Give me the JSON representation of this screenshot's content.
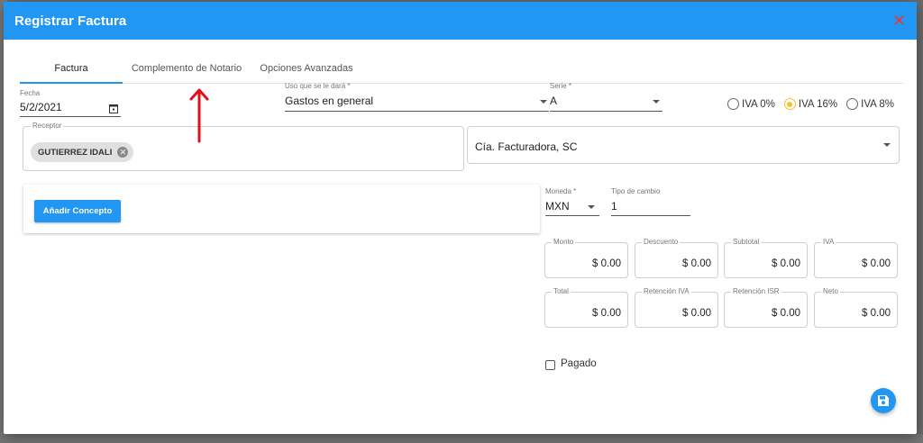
{
  "modal": {
    "title": "Registrar Factura",
    "close_icon": "close-icon"
  },
  "tabs": [
    {
      "label": "Factura",
      "active": true
    },
    {
      "label": "Complemento de Notario",
      "active": false
    },
    {
      "label": "Opciones Avanzadas",
      "active": false
    }
  ],
  "fecha": {
    "label": "Fecha",
    "value": "5/2/2021"
  },
  "uso": {
    "label": "Uso que se le dará *",
    "value": "Gastos en general"
  },
  "serie": {
    "label": "Serie *",
    "value": "A"
  },
  "iva_options": [
    {
      "label": "IVA 0%",
      "checked": false
    },
    {
      "label": "IVA 16%",
      "checked": true
    },
    {
      "label": "IVA 8%",
      "checked": false
    }
  ],
  "receptor": {
    "label": "Receptor",
    "chip": "GUTIERREZ IDALI"
  },
  "emisor": {
    "value": "Cía. Facturadora, SC"
  },
  "add_concept": {
    "label": "Añadir Concepto"
  },
  "moneda": {
    "label": "Moneda *",
    "value": "MXN"
  },
  "tipo_cambio": {
    "label": "Tipo de cambio",
    "value": "1"
  },
  "amounts": [
    {
      "label": "Monto",
      "value": "$ 0.00"
    },
    {
      "label": "Descuento",
      "value": "$ 0.00"
    },
    {
      "label": "Subtotal",
      "value": "$ 0.00"
    },
    {
      "label": "IVA",
      "value": "$ 0.00"
    },
    {
      "label": "Total",
      "value": "$ 0.00"
    },
    {
      "label": "Retención IVA",
      "value": "$ 0.00"
    },
    {
      "label": "Retención ISR",
      "value": "$ 0.00"
    },
    {
      "label": "Neto",
      "value": "$ 0.00"
    }
  ],
  "pagado": {
    "label": "Pagado",
    "checked": false
  },
  "colors": {
    "primary": "#2196f3",
    "close": "#e53935",
    "radio_checked": "#fbc02d",
    "annotation_arrow": "#e0101a"
  }
}
